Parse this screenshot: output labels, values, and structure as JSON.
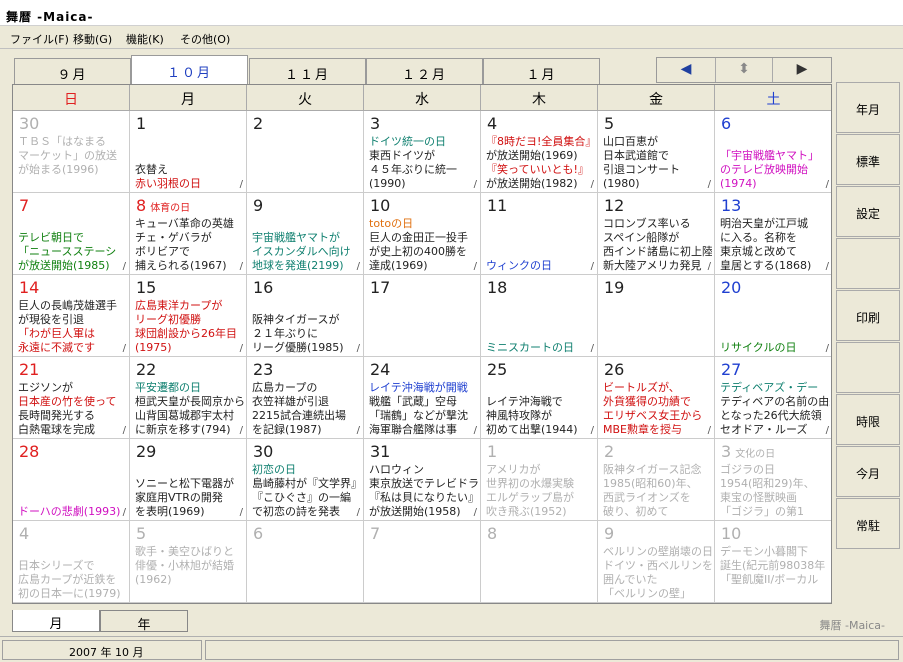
{
  "title": "舞暦 -Maica-",
  "menu": [
    "ファイル(F)",
    "移動(G)",
    "機能(K)",
    "その他(O)"
  ],
  "month_tabs": [
    "９月",
    "１０月",
    "１１月",
    "１２月",
    "１月"
  ],
  "nav": {
    "left": "◀",
    "mid": "⬍",
    "right": "▶"
  },
  "dow": [
    "日",
    "月",
    "火",
    "水",
    "木",
    "金",
    "土"
  ],
  "colors": {
    "sunday": "#e02020",
    "saturday": "#2040d0",
    "gray": "#b0b0b0",
    "blue": "#2040d0",
    "red": "#d01010",
    "green": "#108010",
    "teal": "#108070",
    "magenta": "#d010c0",
    "orange": "#e07010",
    "black": "#222"
  },
  "side_buttons": [
    "年月",
    "標準",
    "設定",
    "",
    "印刷",
    "",
    "時限",
    "今月",
    "常駐"
  ],
  "bottom_tabs": [
    "月",
    "年"
  ],
  "app_name": "舞暦 -Maica-",
  "status": "2007 年 10 月",
  "weeks": [
    [
      {
        "d": "30",
        "c": "gray",
        "ev": [
          {
            "t": "ＴＢＳ「はなまる",
            "c": "gray"
          },
          {
            "t": "マーケット」の放送",
            "c": "gray"
          },
          {
            "t": "が始まる(1996)",
            "c": "gray"
          }
        ]
      },
      {
        "d": "1",
        "c": "black",
        "ev": [
          {
            "t": "",
            "c": "black"
          },
          {
            "t": "",
            "c": "black"
          },
          {
            "t": "衣替え",
            "c": "black"
          },
          {
            "t": "赤い羽根の日",
            "c": "red"
          }
        ]
      },
      {
        "d": "2",
        "c": "black",
        "ev": []
      },
      {
        "d": "3",
        "c": "black",
        "ev": [
          {
            "t": "ドイツ統一の日",
            "c": "teal"
          },
          {
            "t": "東西ドイツが",
            "c": "black"
          },
          {
            "t": "４５年ぶりに統一",
            "c": "black"
          },
          {
            "t": "(1990)",
            "c": "black"
          }
        ]
      },
      {
        "d": "4",
        "c": "black",
        "ev": [
          {
            "t": "『8時だヨ!全員集合』",
            "c": "red"
          },
          {
            "t": "が放送開始(1969)",
            "c": "black"
          },
          {
            "t": "『笑っていいとも!』",
            "c": "red"
          },
          {
            "t": "が放送開始(1982)",
            "c": "black"
          }
        ]
      },
      {
        "d": "5",
        "c": "black",
        "ev": [
          {
            "t": "山口百恵が",
            "c": "black"
          },
          {
            "t": "日本武道館で",
            "c": "black"
          },
          {
            "t": "引退コンサート",
            "c": "black"
          },
          {
            "t": "(1980)",
            "c": "black"
          }
        ]
      },
      {
        "d": "6",
        "c": "blue",
        "ev": [
          {
            "t": "",
            "c": "black"
          },
          {
            "t": "「宇宙戦艦ヤマト」",
            "c": "magenta"
          },
          {
            "t": "のテレビ放映開始",
            "c": "magenta"
          },
          {
            "t": "(1974)",
            "c": "magenta"
          }
        ]
      }
    ],
    [
      {
        "d": "7",
        "c": "sunday",
        "tag": "",
        "ev": [
          {
            "t": "",
            "c": "black"
          },
          {
            "t": "テレビ朝日で",
            "c": "green"
          },
          {
            "t": "「ニュースステーシ",
            "c": "green"
          },
          {
            "t": "が放送開始(1985)",
            "c": "green"
          }
        ]
      },
      {
        "d": "8",
        "c": "sunday",
        "tag": "体育の日",
        "ev": [
          {
            "t": "キューバ革命の英雄",
            "c": "black"
          },
          {
            "t": "チェ・ゲバラが",
            "c": "black"
          },
          {
            "t": "ボリビアで",
            "c": "black"
          },
          {
            "t": "捕えられる(1967)",
            "c": "black"
          }
        ]
      },
      {
        "d": "9",
        "c": "black",
        "ev": [
          {
            "t": "",
            "c": "black"
          },
          {
            "t": "宇宙戦艦ヤマトが",
            "c": "teal"
          },
          {
            "t": "イスカンダルへ向け",
            "c": "teal"
          },
          {
            "t": "地球を発進(2199)",
            "c": "teal"
          }
        ]
      },
      {
        "d": "10",
        "c": "black",
        "ev": [
          {
            "t": "totoの日",
            "c": "orange"
          },
          {
            "t": "巨人の金田正一投手",
            "c": "black"
          },
          {
            "t": "が史上初の400勝を",
            "c": "black"
          },
          {
            "t": "達成(1969)",
            "c": "black"
          }
        ]
      },
      {
        "d": "11",
        "c": "black",
        "ev": [
          {
            "t": "",
            "c": "black"
          },
          {
            "t": "",
            "c": "black"
          },
          {
            "t": "",
            "c": "black"
          },
          {
            "t": "ウィンクの日",
            "c": "blue"
          }
        ]
      },
      {
        "d": "12",
        "c": "black",
        "ev": [
          {
            "t": "コロンブス率いる",
            "c": "black"
          },
          {
            "t": "スペイン船隊が",
            "c": "black"
          },
          {
            "t": "西インド諸島に初上陸",
            "c": "black"
          },
          {
            "t": "新大陸アメリカ発見",
            "c": "black"
          }
        ]
      },
      {
        "d": "13",
        "c": "blue",
        "ev": [
          {
            "t": "明治天皇が江戸城",
            "c": "black"
          },
          {
            "t": "に入る。名称を",
            "c": "black"
          },
          {
            "t": "東京城と改めて",
            "c": "black"
          },
          {
            "t": "皇居とする(1868)",
            "c": "black"
          }
        ]
      }
    ],
    [
      {
        "d": "14",
        "c": "sunday",
        "ev": [
          {
            "t": "巨人の長嶋茂雄選手",
            "c": "black"
          },
          {
            "t": "が現役を引退",
            "c": "black"
          },
          {
            "t": "「わが巨人軍は",
            "c": "red"
          },
          {
            "t": "永遠に不滅です",
            "c": "red"
          }
        ]
      },
      {
        "d": "15",
        "c": "black",
        "ev": [
          {
            "t": "広島東洋カープが",
            "c": "red"
          },
          {
            "t": "リーグ初優勝",
            "c": "red"
          },
          {
            "t": "球団創設から26年目",
            "c": "red"
          },
          {
            "t": "(1975)",
            "c": "red"
          }
        ]
      },
      {
        "d": "16",
        "c": "black",
        "ev": [
          {
            "t": "",
            "c": "black"
          },
          {
            "t": "阪神タイガースが",
            "c": "black"
          },
          {
            "t": "２１年ぶりに",
            "c": "black"
          },
          {
            "t": "リーグ優勝(1985)",
            "c": "black"
          }
        ]
      },
      {
        "d": "17",
        "c": "black",
        "ev": []
      },
      {
        "d": "18",
        "c": "black",
        "ev": [
          {
            "t": "",
            "c": "black"
          },
          {
            "t": "",
            "c": "black"
          },
          {
            "t": "",
            "c": "black"
          },
          {
            "t": "ミニスカートの日",
            "c": "teal"
          }
        ]
      },
      {
        "d": "19",
        "c": "black",
        "ev": []
      },
      {
        "d": "20",
        "c": "blue",
        "ev": [
          {
            "t": "",
            "c": "black"
          },
          {
            "t": "",
            "c": "black"
          },
          {
            "t": "",
            "c": "black"
          },
          {
            "t": "リサイクルの日",
            "c": "green"
          }
        ]
      }
    ],
    [
      {
        "d": "21",
        "c": "sunday",
        "ev": [
          {
            "t": "エジソンが",
            "c": "black"
          },
          {
            "t": "日本産の竹を使って",
            "c": "red"
          },
          {
            "t": "長時間発光する",
            "c": "black"
          },
          {
            "t": "白熱電球を完成",
            "c": "black"
          }
        ]
      },
      {
        "d": "22",
        "c": "black",
        "ev": [
          {
            "t": "平安遷都の日",
            "c": "teal"
          },
          {
            "t": "桓武天皇が長岡京から",
            "c": "black"
          },
          {
            "t": "山背国葛城郡宇太村",
            "c": "black"
          },
          {
            "t": "に新京を移す(794)",
            "c": "black"
          }
        ]
      },
      {
        "d": "23",
        "c": "black",
        "ev": [
          {
            "t": "広島カープの",
            "c": "black"
          },
          {
            "t": "衣笠祥雄が引退",
            "c": "black"
          },
          {
            "t": "2215試合連続出場",
            "c": "black"
          },
          {
            "t": "を記録(1987)",
            "c": "black"
          }
        ]
      },
      {
        "d": "24",
        "c": "black",
        "ev": [
          {
            "t": "レイテ沖海戦が開戦",
            "c": "blue"
          },
          {
            "t": "戦艦「武蔵」空母",
            "c": "black"
          },
          {
            "t": "「瑞鶴」などが撃沈",
            "c": "black"
          },
          {
            "t": "海軍聯合艦隊は事",
            "c": "black"
          }
        ]
      },
      {
        "d": "25",
        "c": "black",
        "ev": [
          {
            "t": "",
            "c": "black"
          },
          {
            "t": "レイテ沖海戦で",
            "c": "black"
          },
          {
            "t": "神風特攻隊が",
            "c": "black"
          },
          {
            "t": "初めて出撃(1944)",
            "c": "black"
          }
        ]
      },
      {
        "d": "26",
        "c": "black",
        "ev": [
          {
            "t": "ビートルズが、",
            "c": "red"
          },
          {
            "t": "外貨獲得の功績で",
            "c": "red"
          },
          {
            "t": "エリザベス女王から",
            "c": "red"
          },
          {
            "t": "MBE勲章を授与",
            "c": "red"
          }
        ]
      },
      {
        "d": "27",
        "c": "blue",
        "ev": [
          {
            "t": "テディベアズ・デー",
            "c": "teal"
          },
          {
            "t": "テディベアの名前の由来",
            "c": "black"
          },
          {
            "t": "となった26代大統領",
            "c": "black"
          },
          {
            "t": "セオドア・ルーズ",
            "c": "black"
          }
        ]
      }
    ],
    [
      {
        "d": "28",
        "c": "sunday",
        "ev": [
          {
            "t": "",
            "c": "black"
          },
          {
            "t": "",
            "c": "black"
          },
          {
            "t": "",
            "c": "black"
          },
          {
            "t": "ドーハの悲劇(1993)",
            "c": "magenta"
          }
        ]
      },
      {
        "d": "29",
        "c": "black",
        "ev": [
          {
            "t": "",
            "c": "black"
          },
          {
            "t": "ソニーと松下電器が",
            "c": "black"
          },
          {
            "t": "家庭用VTRの開発",
            "c": "black"
          },
          {
            "t": "を表明(1969)",
            "c": "black"
          }
        ]
      },
      {
        "d": "30",
        "c": "black",
        "ev": [
          {
            "t": "初恋の日",
            "c": "teal"
          },
          {
            "t": "島崎藤村が『文学界』",
            "c": "black"
          },
          {
            "t": "『こひぐさ』の一編",
            "c": "black"
          },
          {
            "t": "で初恋の詩を発表",
            "c": "black"
          }
        ]
      },
      {
        "d": "31",
        "c": "black",
        "ev": [
          {
            "t": "ハロウィン",
            "c": "black"
          },
          {
            "t": "東京放送でテレビドラマ",
            "c": "black"
          },
          {
            "t": "『私は貝になりたい』",
            "c": "black"
          },
          {
            "t": "が放送開始(1958)",
            "c": "black"
          }
        ]
      },
      {
        "d": "1",
        "c": "gray",
        "ev": [
          {
            "t": "アメリカが",
            "c": "gray"
          },
          {
            "t": "世界初の水爆実験",
            "c": "gray"
          },
          {
            "t": "エルゲラップ島が",
            "c": "gray"
          },
          {
            "t": "吹き飛ぶ(1952)",
            "c": "gray"
          }
        ]
      },
      {
        "d": "2",
        "c": "gray",
        "ev": [
          {
            "t": "阪神タイガース記念",
            "c": "gray"
          },
          {
            "t": "1985(昭和60)年、",
            "c": "gray"
          },
          {
            "t": "西武ライオンズを",
            "c": "gray"
          },
          {
            "t": "破り、初めて",
            "c": "gray"
          }
        ]
      },
      {
        "d": "3",
        "c": "gray",
        "tag": "文化の日",
        "ev": [
          {
            "t": "ゴジラの日",
            "c": "gray"
          },
          {
            "t": "1954(昭和29)年、",
            "c": "gray"
          },
          {
            "t": "東宝の怪獣映画",
            "c": "gray"
          },
          {
            "t": "「ゴジラ」の第1",
            "c": "gray"
          }
        ]
      }
    ],
    [
      {
        "d": "4",
        "c": "gray",
        "ev": [
          {
            "t": "",
            "c": "black"
          },
          {
            "t": "日本シリーズで",
            "c": "gray"
          },
          {
            "t": "広島カープが近鉄を",
            "c": "gray"
          },
          {
            "t": "初の日本一に(1979)",
            "c": "gray"
          }
        ]
      },
      {
        "d": "5",
        "c": "gray",
        "ev": [
          {
            "t": "歌手・美空ひばりと",
            "c": "gray"
          },
          {
            "t": "俳優・小林旭が結婚",
            "c": "gray"
          },
          {
            "t": "(1962)",
            "c": "gray"
          }
        ]
      },
      {
        "d": "6",
        "c": "gray",
        "ev": []
      },
      {
        "d": "7",
        "c": "gray",
        "ev": []
      },
      {
        "d": "8",
        "c": "gray",
        "ev": []
      },
      {
        "d": "9",
        "c": "gray",
        "ev": [
          {
            "t": "ベルリンの壁崩壊の日",
            "c": "gray"
          },
          {
            "t": "ドイツ・西ベルリンを",
            "c": "gray"
          },
          {
            "t": "囲んでいた",
            "c": "gray"
          },
          {
            "t": "「ベルリンの壁」",
            "c": "gray"
          }
        ]
      },
      {
        "d": "10",
        "c": "gray",
        "ev": [
          {
            "t": "デーモン小暮閣下",
            "c": "gray"
          },
          {
            "t": "誕生(紀元前98038年",
            "c": "gray"
          },
          {
            "t": "「聖飢魔II/ボーカル",
            "c": "gray"
          }
        ]
      }
    ]
  ],
  "slash": "/"
}
